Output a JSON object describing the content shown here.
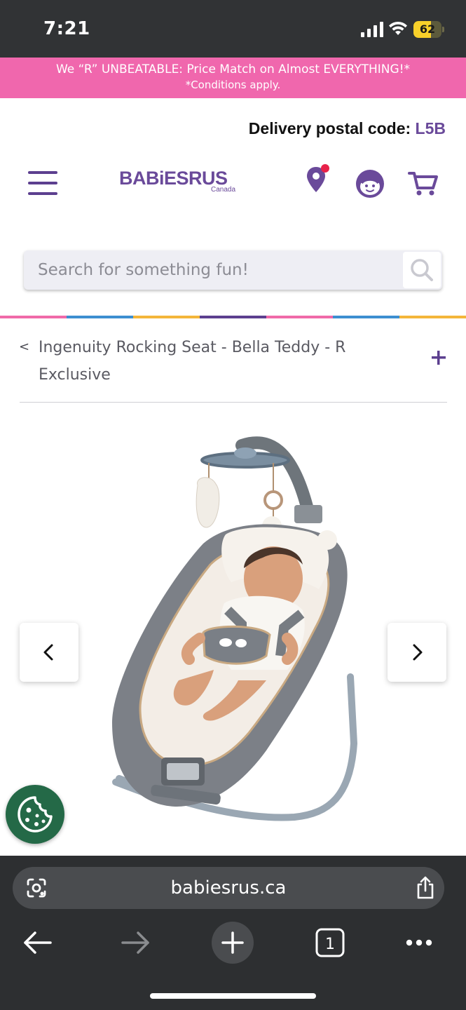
{
  "status_bar": {
    "time": "7:21",
    "battery_level": "62",
    "battery_fraction": 0.62,
    "icons": [
      "signal-icon",
      "wifi-icon",
      "battery-icon"
    ]
  },
  "promo": {
    "line1": "We “R” UNBEATABLE: Price Match on Almost EVERYTHING!*",
    "line2": "*Conditions apply.",
    "color": "#f067ad"
  },
  "delivery": {
    "label": "Delivery postal code:",
    "code": "L5B"
  },
  "header": {
    "logo_text": "BABiESRUS",
    "logo_sub": "Canada",
    "brand_color": "#6a4a9a",
    "icons": [
      "menu-icon",
      "location-pin-icon",
      "account-face-icon",
      "cart-icon"
    ]
  },
  "search": {
    "placeholder": "Search for something fun!",
    "value": ""
  },
  "color_strip": [
    "#f06aa8",
    "#3d8fd0",
    "#f4b63a",
    "#5c3f8f",
    "#f06aa8",
    "#3d8fd0",
    "#f4b63a"
  ],
  "breadcrumb": {
    "back_glyph": "<",
    "title": "Ingenuity Rocking Seat - Bella Teddy - R Exclusive",
    "expand_glyph": "+"
  },
  "product": {
    "image_alt": "Ingenuity Rocking Seat - Bella Teddy - R Exclusive",
    "prev_icon": "chevron-left-icon",
    "next_icon": "chevron-right-icon"
  },
  "cookie_button": {
    "icon": "cookie-icon",
    "color": "#246947"
  },
  "browser": {
    "url": "babiesrus.ca",
    "tab_count": "1",
    "icons": [
      "lens-icon",
      "share-icon",
      "back-arrow-icon",
      "forward-arrow-icon",
      "new-tab-plus-icon",
      "tabs-icon",
      "more-dots-icon"
    ]
  }
}
